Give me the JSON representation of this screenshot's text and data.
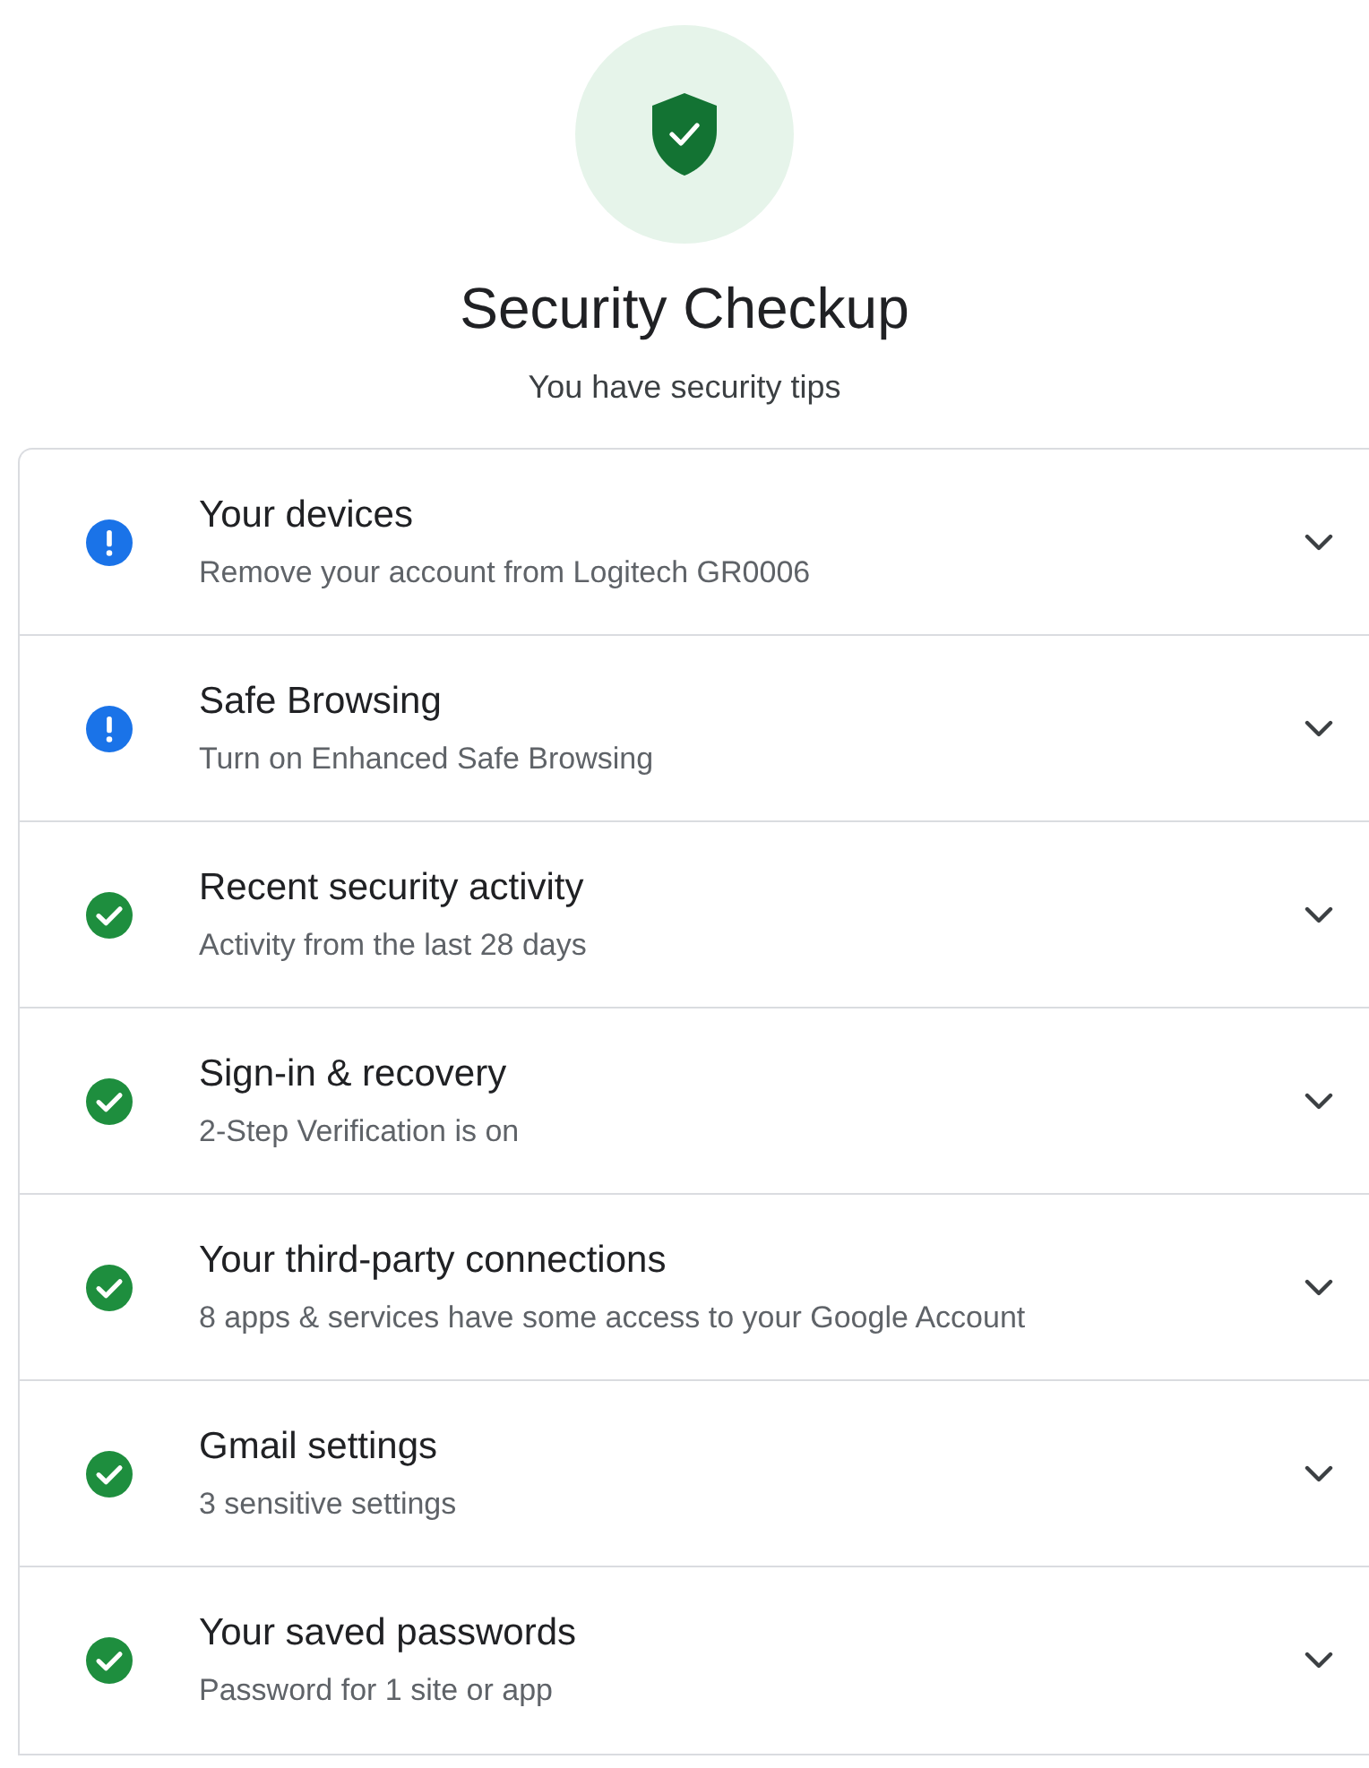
{
  "header": {
    "title": "Security Checkup",
    "subtitle": "You have security tips"
  },
  "items": [
    {
      "kind": "warning",
      "title": "Your devices",
      "subtitle": "Remove your account from Logitech GR0006"
    },
    {
      "kind": "warning",
      "title": "Safe Browsing",
      "subtitle": "Turn on Enhanced Safe Browsing"
    },
    {
      "kind": "ok",
      "title": "Recent security activity",
      "subtitle": "Activity from the last 28 days"
    },
    {
      "kind": "ok",
      "title": "Sign-in & recovery",
      "subtitle": "2-Step Verification is on"
    },
    {
      "kind": "ok",
      "title": "Your third-party connections",
      "subtitle": "8 apps & services have some access to your Google Account"
    },
    {
      "kind": "ok",
      "title": "Gmail settings",
      "subtitle": "3 sensitive settings"
    },
    {
      "kind": "ok",
      "title": "Your saved passwords",
      "subtitle": "Password for 1 site or app"
    }
  ]
}
